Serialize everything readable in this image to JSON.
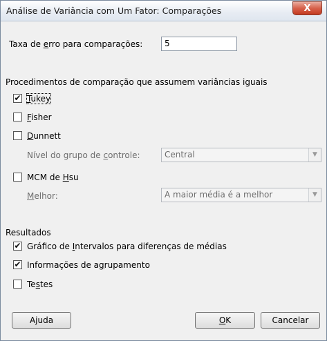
{
  "window": {
    "title": "Análise de Variância com Um Fator: Comparações",
    "close_glyph": "X"
  },
  "error_rate": {
    "label_pre": "Taxa de ",
    "label_accel": "e",
    "label_post": "rro para comparações:",
    "value": "5"
  },
  "equal_var": {
    "heading": "Procedimentos de comparação que assumem variâncias iguais",
    "tukey": {
      "accel": "T",
      "rest": "ukey",
      "checked": true
    },
    "fisher": {
      "accel": "F",
      "rest": "isher",
      "checked": false
    },
    "dunnett": {
      "accel": "D",
      "rest": "unnett",
      "checked": false
    },
    "control_level": {
      "label_pre": "Nível do grupo de ",
      "label_accel": "c",
      "label_post": "ontrole:",
      "value": "Central"
    },
    "hsu": {
      "pre": "MCM de ",
      "accel": "H",
      "rest": "su",
      "checked": false
    },
    "best": {
      "accel": "M",
      "rest": "elhor:",
      "value": "A maior média é a melhor"
    }
  },
  "results": {
    "heading": "Resultados",
    "interval_plot": {
      "pre": "Gráfico de ",
      "accel": "I",
      "rest": "ntervalos para diferenças de médias",
      "checked": true
    },
    "grouping": {
      "pre": "Informações de a",
      "accel": "g",
      "rest": "rupamento",
      "checked": true
    },
    "tests": {
      "pre": "Te",
      "accel": "s",
      "rest": "tes",
      "checked": false
    }
  },
  "buttons": {
    "help": "Ajuda",
    "ok_accel": "O",
    "ok_rest": "K",
    "cancel": "Cancelar"
  },
  "check_glyph": "✔"
}
